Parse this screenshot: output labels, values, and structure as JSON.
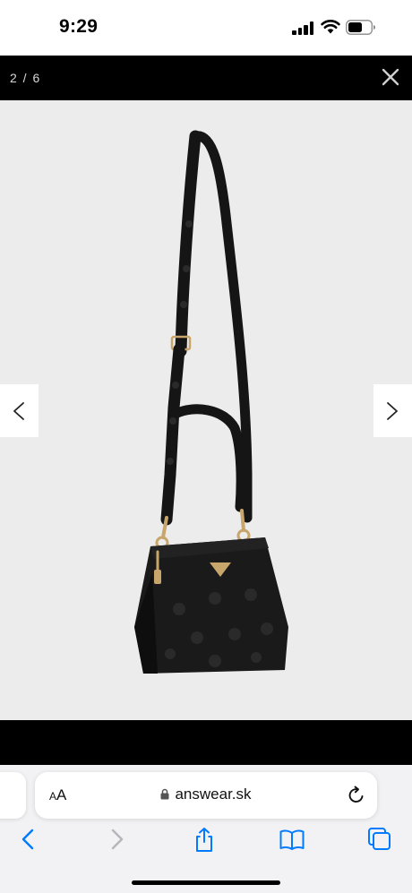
{
  "status_bar": {
    "time": "9:29",
    "signal_icon": "cellular-signal-icon",
    "wifi_icon": "wifi-icon",
    "battery_icon": "battery-icon"
  },
  "gallery": {
    "counter": "2 / 6",
    "close_icon": "close-icon",
    "prev_icon": "chevron-left-icon",
    "next_icon": "chevron-right-icon",
    "image": "black shoulder bag with logo-embossed strap and gold hardware",
    "background_color": "#ececed"
  },
  "safari": {
    "text_size_small": "A",
    "text_size_large": "A",
    "url": "answear.sk",
    "lock_icon": "lock-icon",
    "reload_icon": "reload-icon",
    "toolbar": [
      "back-icon",
      "forward-icon",
      "share-icon",
      "bookmarks-icon",
      "tabs-icon"
    ],
    "accent_color": "#007aff",
    "disabled_color": "#b5b5bb"
  }
}
